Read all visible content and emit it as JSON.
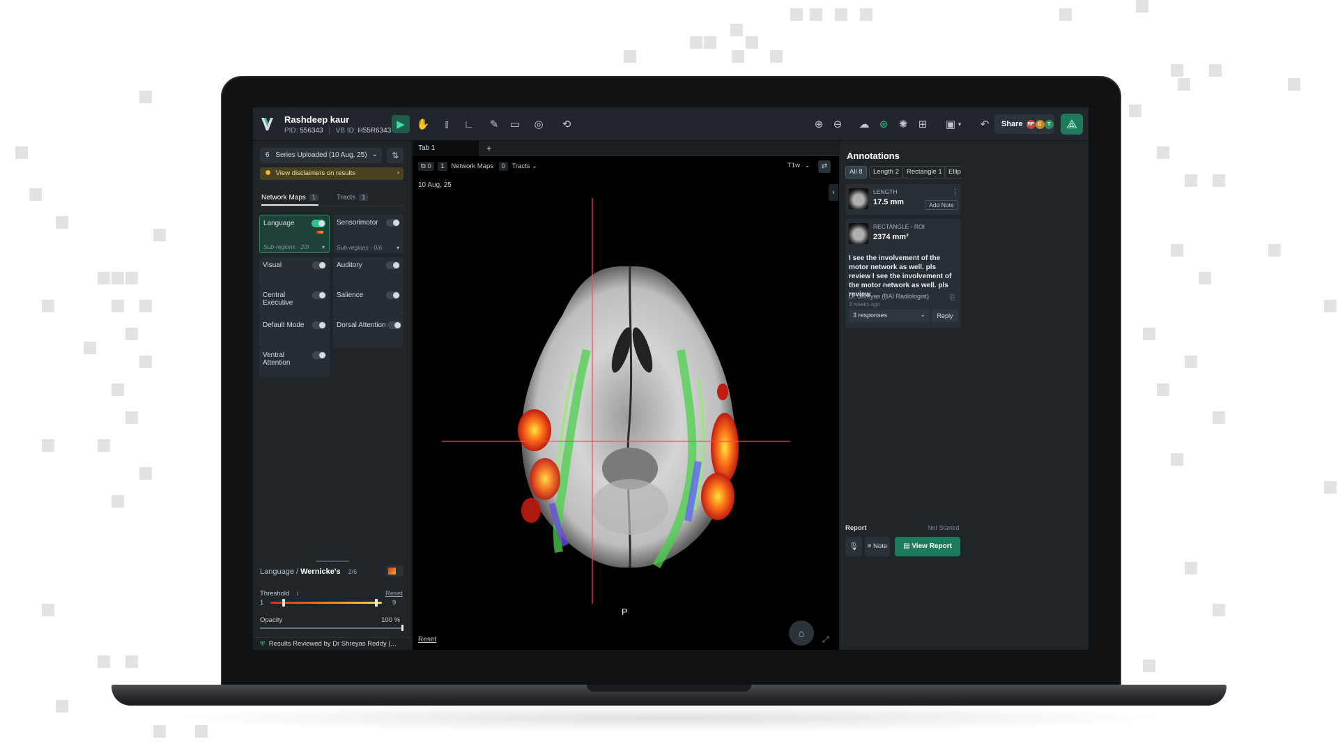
{
  "patient": {
    "name": "Rashdeep kaur",
    "pid_label": "PID:",
    "pid": "556343",
    "vb_label": "VB ID:",
    "vb": "H55R6343"
  },
  "toolbar": {
    "share_label": "Share",
    "avatars": [
      "RF",
      "C",
      "T"
    ]
  },
  "left": {
    "series_count": "6",
    "series_label": "Series Uploaded (10 Aug, 25)",
    "disclaimer": "View disclaimers on results",
    "tabs": [
      {
        "label": "Network Maps",
        "count": "1"
      },
      {
        "label": "Tracts",
        "count": "1"
      }
    ],
    "networks": [
      {
        "label": "Language",
        "sub": "Sub-regions · 2/9",
        "on": true
      },
      {
        "label": "Sensorimotor",
        "sub": "Sub-regions · 0/6",
        "on": false
      },
      {
        "label": "Visual",
        "sub": "",
        "on": false
      },
      {
        "label": "Auditory",
        "sub": "",
        "on": false
      },
      {
        "label": "Central Executive",
        "sub": "",
        "on": false
      },
      {
        "label": "Salience",
        "sub": "",
        "on": false
      },
      {
        "label": "Default Mode",
        "sub": "",
        "on": false
      },
      {
        "label": "Dorsal Attention",
        "sub": "",
        "on": false
      },
      {
        "label": "Ventral Attention",
        "sub": "",
        "on": false
      }
    ],
    "detail": {
      "network": "Language /",
      "region": "Wernicke's",
      "count": "2/6",
      "threshold_label": "Threshold",
      "threshold_info": "i",
      "reset_label": "Reset",
      "threshold_min": "1",
      "threshold_max": "9",
      "threshold_low_fraction": 0.12,
      "threshold_high_fraction": 0.95,
      "opacity_label": "Opacity",
      "opacity_value": "100 %"
    },
    "reviewed": "Results Reviewed by Dr Shreyas Reddy (..."
  },
  "viewer": {
    "tab_label": "Tab 1",
    "layer_count": "0",
    "network_maps_count": "1",
    "network_maps_label": "Network Maps",
    "tracts_count": "0",
    "tracts_label": "Tracts",
    "date": "10 Aug, 25",
    "sequence": "T1w",
    "orientation": "P",
    "reset_label": "Reset"
  },
  "annotations": {
    "title": "Annotations",
    "filters": [
      {
        "label": "All",
        "count": "8"
      },
      {
        "label": "Length",
        "count": "2"
      },
      {
        "label": "Rectangle",
        "count": "1"
      },
      {
        "label": "Ellips",
        "count": ""
      }
    ],
    "items": [
      {
        "type": "LENGTH",
        "value": "17.5 mm",
        "action": "Add Note"
      },
      {
        "type": "RECTANGLE - ROI",
        "value": "2374 mm²"
      }
    ],
    "comment": "I see the involvement of the motor network as well. pls review I see the involvement of the motor network as well. pls review",
    "author": "Dr Shreyas (BAI Radiologist)",
    "time": "3 weeks ago",
    "responses": "3 responses",
    "reply_label": "Reply",
    "report_label": "Report",
    "report_status": "Not Started",
    "note_label": "Note",
    "view_report_label": "View Report"
  },
  "colors": {
    "accent": "#2fc489",
    "primary_button": "#1e7a5c",
    "activation_hot": "#d9301a",
    "activation_warm": "#f0b429"
  }
}
